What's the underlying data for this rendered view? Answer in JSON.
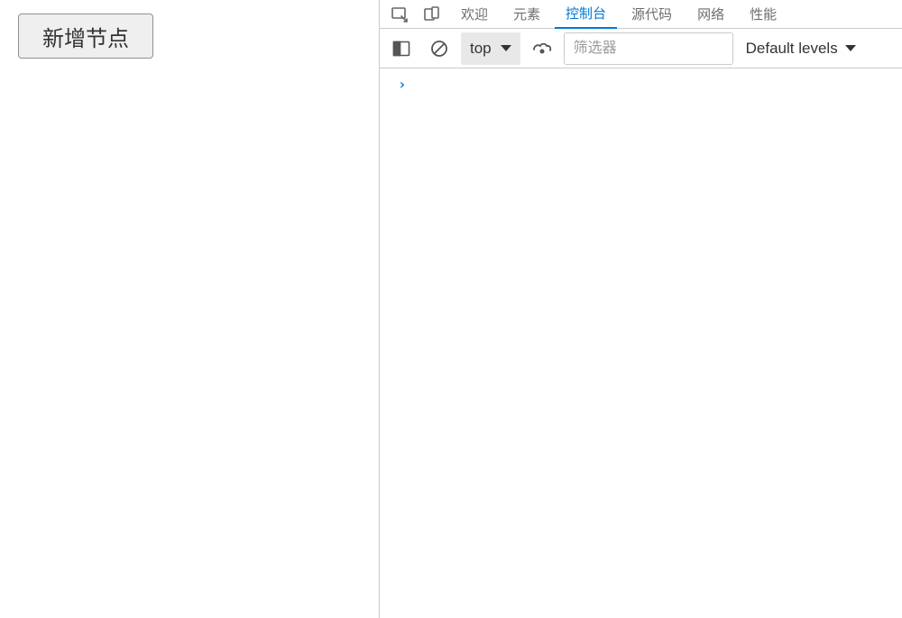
{
  "page": {
    "addButtonLabel": "新增节点"
  },
  "devtools": {
    "tabs": {
      "welcome": "欢迎",
      "elements": "元素",
      "console": "控制台",
      "sources": "源代码",
      "network": "网络",
      "performance": "性能"
    },
    "toolbar": {
      "contextLabel": "top",
      "filterPlaceholder": "筛选器",
      "levelsLabel": "Default levels"
    },
    "console": {
      "prompt": "›"
    }
  }
}
